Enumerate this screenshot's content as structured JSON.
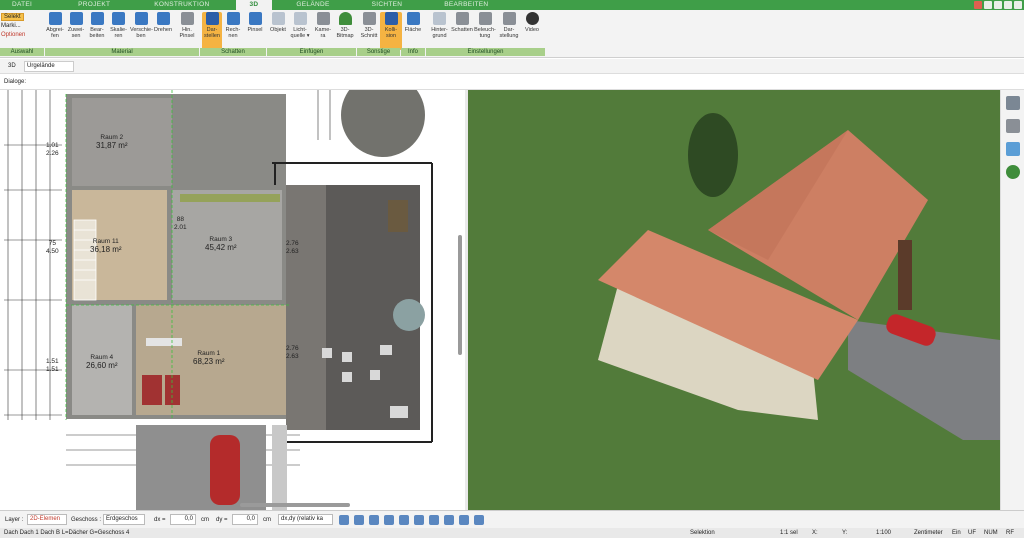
{
  "tabs": [
    "DATEI",
    "PROJEKT",
    "KONSTRUKTION",
    "3D",
    "GELÄNDE",
    "SICHTEN",
    "BEARBEITEN"
  ],
  "ribbon": {
    "selekt": "Selekt",
    "markieren": "Marki...",
    "optionen": "Optionen",
    "buttons": [
      {
        "label": "Abgrei-\nfen"
      },
      {
        "label": "Zuwei-\nsen"
      },
      {
        "label": "Bear-\nbeiten"
      },
      {
        "label": "Skalie-\nren"
      },
      {
        "label": "Verschie-\nben"
      },
      {
        "label": "Drehen"
      },
      {
        "label": "Hin.\nPinsel"
      },
      {
        "label": "Dar-\nstellen"
      },
      {
        "label": "Rech-\nnen"
      },
      {
        "label": "Pinsel"
      },
      {
        "label": "Objekt"
      },
      {
        "label": "Licht-\nquelle ▾"
      },
      {
        "label": "Kame-\nra"
      },
      {
        "label": "3D-\nBitmap"
      },
      {
        "label": "3D-\nSchnitt"
      },
      {
        "label": "Kolli-\nsion"
      },
      {
        "label": "Fläche"
      },
      {
        "label": "Hinter-\ngrund"
      },
      {
        "label": "Schatten"
      },
      {
        "label": "Beleuch-\ntung"
      },
      {
        "label": "Dar-\nstellung"
      },
      {
        "label": "Video"
      }
    ],
    "groups": [
      "Auswahl",
      "Material",
      "Schatten",
      "Einfügen",
      "Sonstige",
      "Info",
      "Einstellungen"
    ]
  },
  "row2": {
    "label": "3D",
    "dropdown": "Urgelände"
  },
  "row3": {
    "label": "Dialoge:"
  },
  "plan": {
    "rooms": [
      {
        "name": "Raum 2",
        "area": "31,87 m²"
      },
      {
        "name": "Raum 11",
        "area": "36,18 m²"
      },
      {
        "name": "Raum 3",
        "area": "45,42 m²"
      },
      {
        "name": "Raum 4",
        "area": "26,60 m²"
      },
      {
        "name": "Raum 1",
        "area": "68,23 m²"
      }
    ],
    "dims": [
      "1.01",
      "2.26",
      "75",
      "4.50",
      "1.51",
      "1.51",
      "88",
      "2.01",
      "2.76",
      "2.63",
      "2.76",
      "2.63"
    ]
  },
  "status": {
    "layer_label": "Layer :",
    "layer_value": "2D-Elemen",
    "geschoss_label": "Geschoss :",
    "geschoss_value": "Erdgeschos",
    "dx_label": "dx =",
    "dx_value": "0,0",
    "dx_unit": "cm",
    "dy_label": "dy =",
    "dy_value": "0,0",
    "dy_unit": "cm",
    "mode_value": "dx,dy (relativ ka"
  },
  "footer": {
    "left": "Dach Dach 1 Dach B L=Dächer G=Geschoss 4",
    "selektion": "Selektion",
    "sel": "1:1 sel",
    "x": "X:",
    "y": "Y:",
    "scale": "1:100",
    "unit": "Zentimeter",
    "ein": "Ein",
    "uf": "UF",
    "num": "NUM",
    "rf": "RF"
  },
  "colors": {
    "green": "#3f9e48",
    "ribbon_group": "#a8cf8a",
    "active": "#f5b342",
    "accent": "#3a78c2"
  }
}
